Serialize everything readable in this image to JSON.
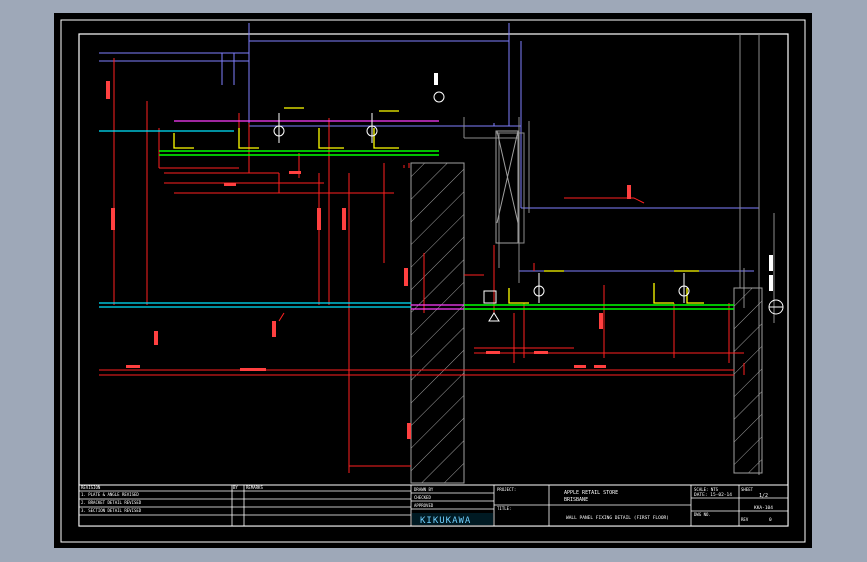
{
  "title_block": {
    "revision_rows": [
      "1. PLATE & ANGLE REVISED",
      "2. BRACKET DETAIL REVISED",
      "3. SECTION DETAIL REVISED"
    ],
    "revision_headers": {
      "no": "REVISION",
      "date": "DATE",
      "by": "BY",
      "remarks": "REMARKS"
    },
    "drawn_labels": [
      "DRAWN BY",
      "CHECKED",
      "APPROVED"
    ],
    "project_label": "PROJECT:",
    "project_name": "APPLE RETAIL STORE",
    "project_location": "BRISBANE",
    "title_label": "TITLE:",
    "drawing_title": "WALL PANEL FIXING DETAIL (FIRST FLOOR)",
    "scale_label": "SCALE: NTS",
    "date_value": "DATE: 15-02-14",
    "sheet_label": "SHEET",
    "sheet_value": "1/2",
    "dwg_no_label": "DWG NO.",
    "dwg_no_value": "KKA-104",
    "rev_label": "REV",
    "rev_value": "0",
    "company": "KIKUKAWA"
  },
  "colors": {
    "sheet_background": "#000000",
    "frame": "#ffffff",
    "dimension": "#ff0000",
    "panel_outline": "#7f7fff",
    "beam_line": "#00ffff",
    "steel_plate": "#00ff00",
    "bracket": "#ffff00",
    "hatch": "#9f9f9f",
    "accent_magenta": "#ff00ff"
  }
}
